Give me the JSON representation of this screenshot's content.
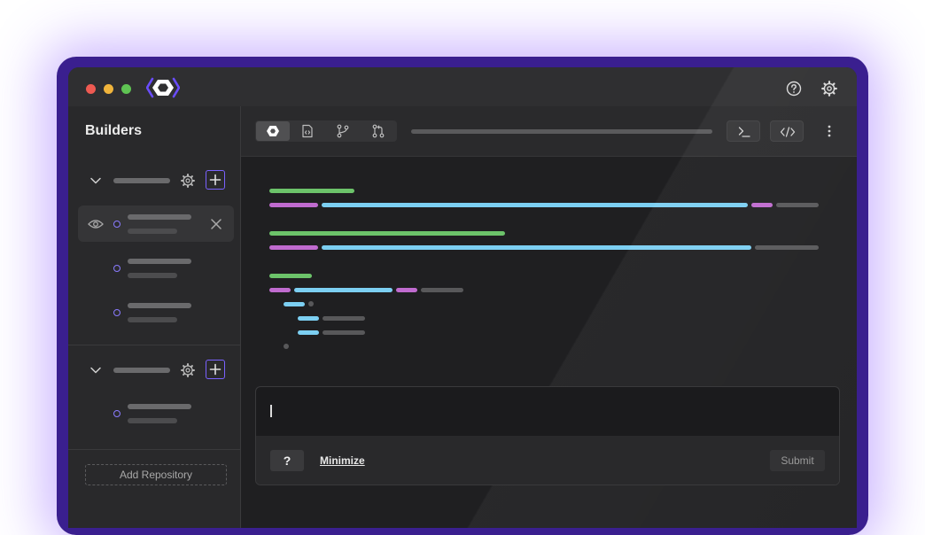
{
  "app": {
    "window_dots": [
      {
        "name": "close",
        "color": "#ee5a52"
      },
      {
        "name": "minimize",
        "color": "#f0b43c"
      },
      {
        "name": "maximize",
        "color": "#5fc453"
      }
    ],
    "logo_icon": "hexagon-brackets-logo",
    "accent_color": "#7a62ff"
  },
  "titlebar": {
    "help_icon": "question-circle-icon",
    "settings_icon": "gear-icon"
  },
  "sidebar": {
    "title": "Builders",
    "groups": [
      {
        "collapse_icon": "chevron-down-icon",
        "settings_icon": "gear-icon",
        "add_icon": "plus-icon"
      },
      {
        "collapse_icon": "chevron-down-icon",
        "settings_icon": "gear-icon",
        "add_icon": "plus-icon"
      }
    ],
    "selected_item_icons": {
      "visibility": "eye-icon",
      "remove": "close-icon"
    },
    "add_repository": "Add Repository"
  },
  "toolbar": {
    "tabs": [
      "hexagon-icon",
      "file-code-icon",
      "git-branch-icon",
      "git-pull-request-icon"
    ],
    "active_tab": 0,
    "right_buttons": [
      "terminal-icon",
      "code-icon"
    ],
    "more_icon": "more-vertical-icon"
  },
  "prompt": {
    "help_label": "?",
    "minimize_label": "Minimize",
    "submit_label": "Submit"
  },
  "colors": {
    "code_green": "#6cc36a",
    "code_pink": "#c06bcf",
    "code_blue": "#7ccff2",
    "code_gray": "#58585a"
  }
}
